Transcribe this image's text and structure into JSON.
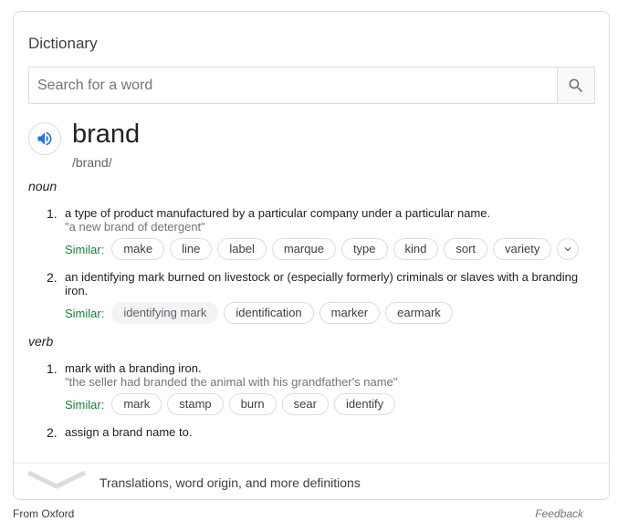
{
  "title": "Dictionary",
  "search": {
    "placeholder": "Search for a word",
    "value": ""
  },
  "entry": {
    "word": "brand",
    "phonetic": "/brand/"
  },
  "senses": [
    {
      "pos": "noun",
      "definitions": [
        {
          "num": "1.",
          "text": "a type of product manufactured by a particular company under a particular name.",
          "example": "\"a new brand of detergent\"",
          "similar_label": "Similar:",
          "similar": [
            "make",
            "line",
            "label",
            "marque",
            "type",
            "kind",
            "sort",
            "variety"
          ]
        },
        {
          "num": "2.",
          "text": "an identifying mark burned on livestock or (especially formerly) criminals or slaves with a branding iron.",
          "similar_label": "Similar:",
          "similar": [
            "identifying mark",
            "identification",
            "marker",
            "earmark"
          ]
        }
      ]
    },
    {
      "pos": "verb",
      "definitions": [
        {
          "num": "1.",
          "text": "mark with a branding iron.",
          "example": "\"the seller had branded the animal with his grandfather's name\"",
          "similar_label": "Similar:",
          "similar": [
            "mark",
            "stamp",
            "burn",
            "sear",
            "identify"
          ]
        },
        {
          "num": "2.",
          "text": "assign a brand name to."
        }
      ]
    }
  ],
  "footer": {
    "more": "Translations, word origin, and more definitions"
  },
  "source": "From Oxford",
  "feedback": "Feedback",
  "colors": {
    "similar": "#188038",
    "accent": "#1a73e8"
  },
  "icons": {
    "search": "search-icon",
    "speaker": "speaker-icon",
    "expand": "chevron-down-icon",
    "footer": "chevron-down-icon"
  }
}
